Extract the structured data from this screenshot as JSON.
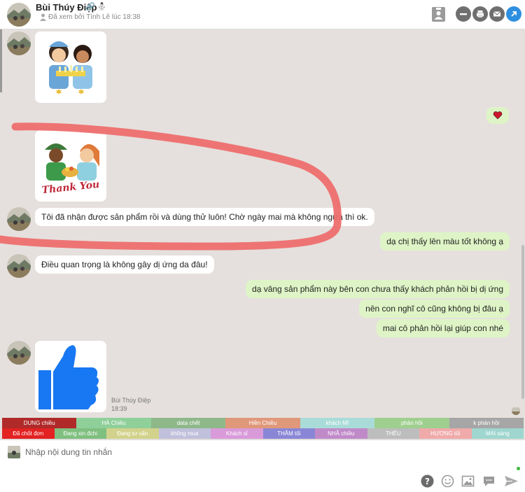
{
  "header": {
    "name": "Bùi Thúy Điệp",
    "seen_text": "Đã xem bởi Tình Lê lúc 18:38"
  },
  "messages": {
    "incoming_1": "Tôi đã nhận được sản phẩm rồi và dùng thử luôn! Chờ ngày mai mà không ngứa thì ok.",
    "outgoing_1": "dạ chị thấy lên màu tốt không ạ",
    "incoming_2": "Điều quan trọng là không gây dị ứng da đâu!",
    "outgoing_2": "dạ vâng sản phẩm này bên con chưa thấy khách phản hồi bị dị ứng",
    "outgoing_3": "nên con nghĩ cô cũng không bị đâu ạ",
    "outgoing_4": "mai cô phản hồi lại giúp con nhé",
    "sticker_thank_you": "Thank You",
    "last_sender": "Bùi Thúy Điệp",
    "last_time": "18:39"
  },
  "tags_row1": [
    {
      "label": "DUNG chiều",
      "color": "#b02a2a"
    },
    {
      "label": "HÀ Chiều",
      "color": "#8fcf9a"
    },
    {
      "label": "data chết",
      "color": "#8fb88a"
    },
    {
      "label": "Hiền Chiều",
      "color": "#e0987a"
    },
    {
      "label": "khách Mĩ",
      "color": "#a9dcd9"
    },
    {
      "label": "phản hồi",
      "color": "#9fcf8f"
    },
    {
      "label": "k phản hồi",
      "color": "#a6a6a6"
    }
  ],
  "tags_row2": [
    {
      "label": "Đã chốt đơn",
      "color": "#e32222"
    },
    {
      "label": "Đang xin đchi",
      "color": "#7fbf7f"
    },
    {
      "label": "Đang tư vấn",
      "color": "#d2d28c"
    },
    {
      "label": "không mua",
      "color": "#c0c0dc"
    },
    {
      "label": "Khách sỉ",
      "color": "#d99ad9"
    },
    {
      "label": "THẮM tối",
      "color": "#8a86d6"
    },
    {
      "label": "NHÃ chiều",
      "color": "#c08ac9"
    },
    {
      "label": "THÊU",
      "color": "#bdbdbd"
    },
    {
      "label": "HƯƠNG tối",
      "color": "#f0aaaa"
    },
    {
      "label": "MAI sáng",
      "color": "#9fd6cf"
    }
  ],
  "composer": {
    "placeholder": "Nhập nội dung tin nhắn"
  },
  "colors": {
    "chat_background": "#e5e0dd",
    "outgoing_bubble": "#def4c6",
    "annotation": "#ee6e6e"
  },
  "icons": {
    "header": [
      "contact-card-icon",
      "minimize-icon",
      "print-icon",
      "mail-icon",
      "open-external-icon"
    ],
    "composer": [
      "help-icon",
      "emoji-icon",
      "image-icon",
      "sticker-icon",
      "send-icon"
    ]
  }
}
